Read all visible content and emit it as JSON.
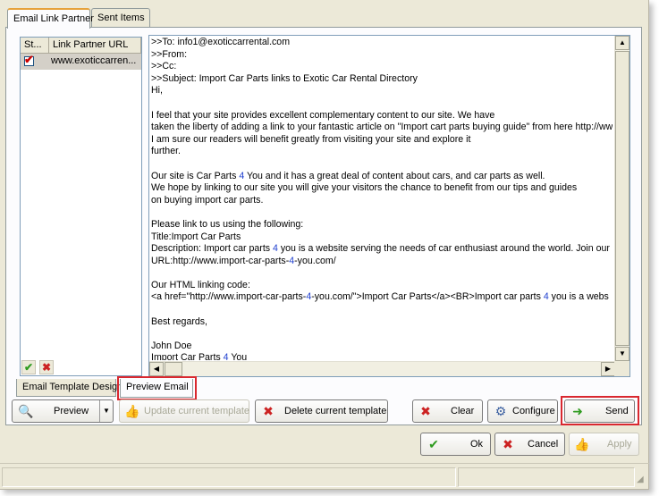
{
  "tabs_outer": [
    {
      "label": "Email Link Partner",
      "active": true
    },
    {
      "label": "Sent Items",
      "active": false
    }
  ],
  "list": {
    "columns": [
      "St...",
      "Link Partner URL"
    ],
    "rows": [
      {
        "checked": true,
        "url": "www.exoticcarren..."
      }
    ]
  },
  "editor": {
    "lines": [
      ">>To: info1@exoticcarrental.com",
      ">>From:",
      ">>Cc:",
      ">>Subject: Import Car Parts links to Exotic Car Rental Directory",
      "Hi,",
      "",
      "I feel that your site provides excellent complementary content to our site. We have",
      "taken the liberty of adding a link to your fantastic article on \"Import cart parts buying guide\" from here http://www",
      "I am sure our readers will benefit greatly from visiting your site and explore it",
      "further.",
      "",
      "Our site is Car Parts 4 You and it has a great deal of content about cars, and car parts as well.",
      "We hope by linking to our site you will give your visitors the chance to benefit from our tips and guides",
      "on buying import car parts.",
      "",
      "Please link to us using the following:",
      "Title:Import Car Parts",
      "Description: Import car parts 4 you is a website serving the needs of car enthusiast around the world. Join our",
      "URL:http://www.import-car-parts-4-you.com/",
      "",
      "Our HTML linking code:",
      "<a href=\"http://www.import-car-parts-4-you.com/\">Import Car Parts</a><BR>Import car parts 4 you is a webs",
      "",
      "Best regards,",
      "",
      "John Doe",
      "Import Car Parts 4 You"
    ],
    "highlight_color": "#1f3fcf"
  },
  "inner_tabs": [
    {
      "label": "Email Template Design",
      "active": false
    },
    {
      "label": "Preview Email",
      "active": true
    }
  ],
  "toolbar": {
    "preview": "Preview",
    "update": "Update current template",
    "delete": "Delete current template",
    "clear": "Clear",
    "configure": "Configure",
    "send": "Send"
  },
  "footer": {
    "ok": "Ok",
    "cancel": "Cancel",
    "apply": "Apply"
  },
  "colors": {
    "accent_red": "#d9282f",
    "ok_green": "#2e9b1f",
    "cancel_red": "#cc2222"
  }
}
